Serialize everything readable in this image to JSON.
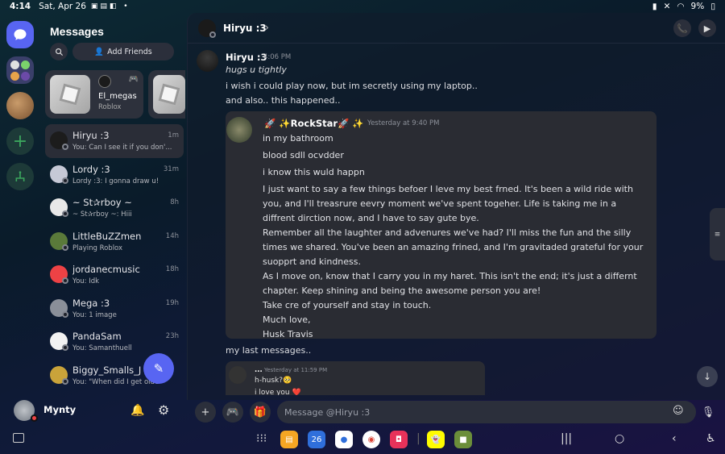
{
  "statusbar": {
    "time": "4:14",
    "date": "Sat, Apr 26",
    "battery": "9%"
  },
  "messages_panel": {
    "title": "Messages",
    "add_friends": "Add Friends",
    "activity": {
      "name": "El_megas",
      "sub": "Roblox"
    },
    "dms": [
      {
        "name": "Hiryu :3",
        "preview": "You: Can I see it if you don'...",
        "time": "1m",
        "avatar": "#1c1c1c",
        "active": true
      },
      {
        "name": "Lordy :3",
        "preview": "Lordy :3: I gonna draw u!",
        "time": "31m",
        "avatar": "#c6c9d6"
      },
      {
        "name": "~ St✰rboy ~",
        "preview": "~ St✰rboy ~: Hiii",
        "time": "8h",
        "avatar": "#e8e8e8"
      },
      {
        "name": "LittleBuZZmen",
        "preview": "Playing Roblox",
        "time": "14h",
        "avatar": "#5a7a3a"
      },
      {
        "name": "jordanecmusic",
        "preview": "You: Idk",
        "time": "18h",
        "avatar": "#ed4245"
      },
      {
        "name": "Mega :3",
        "preview": "You: 1 image",
        "time": "19h",
        "avatar": "#8a8f99"
      },
      {
        "name": "PandaSam",
        "preview": "You: Samanthuell",
        "time": "23h",
        "avatar": "#f2f2f2"
      },
      {
        "name": "Biggy_Smalls_J",
        "preview": "You: \"When did I get olde",
        "time": "",
        "avatar": "#c9a33a"
      }
    ]
  },
  "user": {
    "name": "Mynty"
  },
  "chat": {
    "recipient": "Hiryu :3",
    "messages": [
      {
        "author": "Hiryu :3",
        "time": "4:06 PM",
        "lines": [
          "hugs u tightly",
          "i wish i could play now, but im secretly using my laptop..",
          "and also.. this happened.."
        ]
      }
    ],
    "embed": {
      "author": "🚀 ✨RockStar🚀 ✨",
      "time": "Yesterday at 9:40 PM",
      "paragraphs": [
        "in my bathroom",
        "blood sdll ocvdder",
        "i know this wuld happn",
        "I just want to say a few things befoer I leve my best frned. It's been a wild ride with you, and I'll treasrure eevry moment we've spent togeher. Life is taking me in a diffrent dirction now, and I have to say gute bye.",
        "Remember all the laughter and advenures we've had? I'll miss the fun and the silly times we shared. You've been an amazing frined, and I'm gravitaded grateful for your suopprt and kindness.",
        "As I move on, know that I carry you in my haret. This isn't the end; it's just a differnt chapter. Keep shining and being the awesome person you are!",
        "Take cre of yourself and stay in touch.",
        "Much love,",
        "Husk Travis"
      ]
    },
    "after_embed": "my last messages..",
    "nested": {
      "author": "...",
      "time": "Yesterday at 11:59 PM",
      "lines": [
        "h-husk?🥺",
        "i love you ❤️"
      ]
    },
    "input_placeholder": "Message @Hiryu :3"
  },
  "colors": {
    "blurple": "#5865f2",
    "dnd": "#ed4245",
    "green": "#3ba55d"
  }
}
